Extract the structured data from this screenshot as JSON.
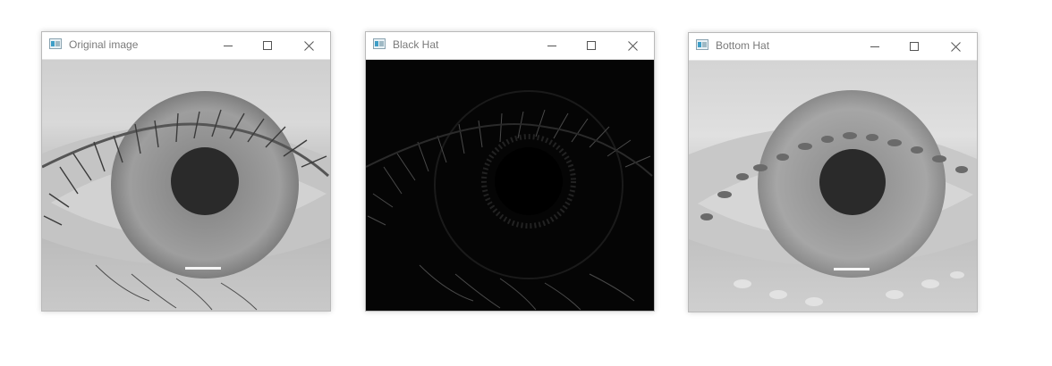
{
  "windows": [
    {
      "title": "Original image",
      "icons": {
        "app": "app-window-icon",
        "minimize": "minimize-icon",
        "maximize": "maximize-icon",
        "close": "close-icon"
      },
      "image": "grayscale photo of a human eye with pupil, iris and eyelashes"
    },
    {
      "title": "Black Hat",
      "icons": {
        "app": "app-window-icon",
        "minimize": "minimize-icon",
        "maximize": "maximize-icon",
        "close": "close-icon"
      },
      "image": "black-hat morphology result: dark image with faint edge lines"
    },
    {
      "title": "Bottom Hat",
      "icons": {
        "app": "app-window-icon",
        "minimize": "minimize-icon",
        "maximize": "maximize-icon",
        "close": "close-icon"
      },
      "image": "bottom-hat morphology result: brightened grayscale eye"
    }
  ],
  "colors": {
    "window_border": "#b9b9b9",
    "title_text": "#7a7a7a",
    "pupil": "#2a2a2a"
  }
}
